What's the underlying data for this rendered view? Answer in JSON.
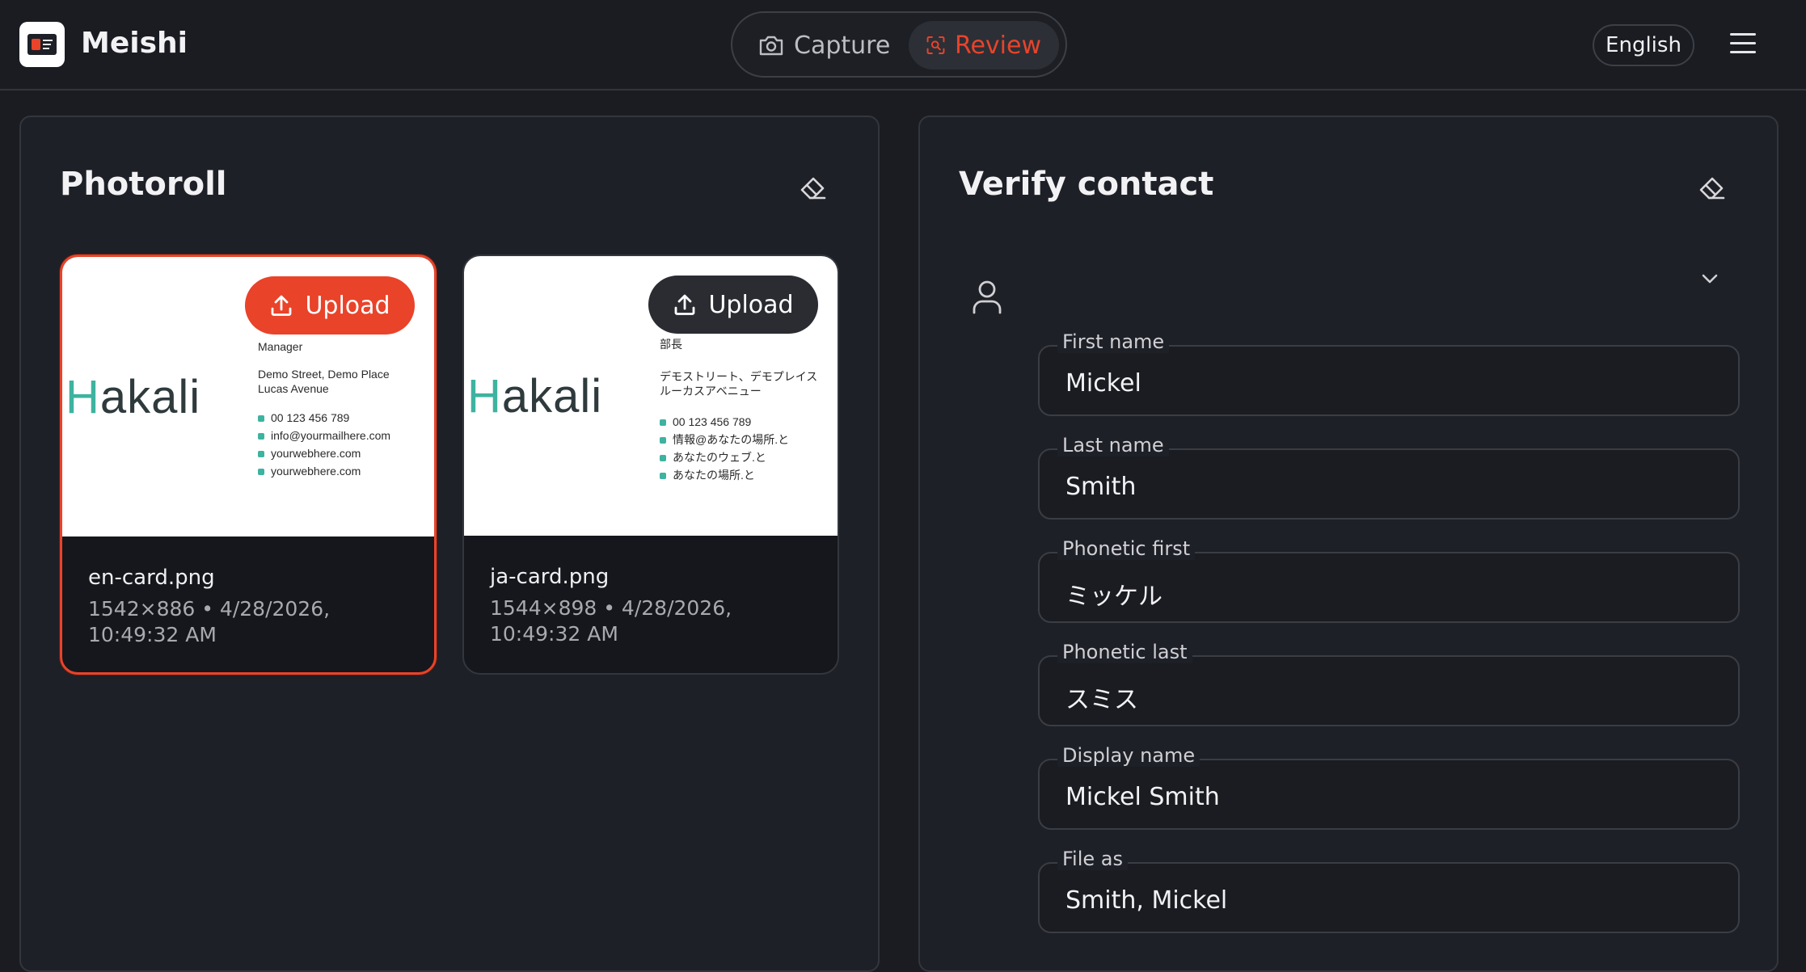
{
  "header": {
    "app_title": "Meishi",
    "nav": {
      "capture_label": "Capture",
      "review_label": "Review"
    },
    "language": "English",
    "accent_color": "#e9432a"
  },
  "photoroll": {
    "title": "Photoroll",
    "cards": [
      {
        "upload_label": "Upload",
        "file_name": "en-card.png",
        "meta": "1542×886 • 4/28/2026, 10:49:32 AM",
        "selected": true,
        "preview": {
          "logo_prefix": "H",
          "logo_suffix": "akali",
          "role": "Manager",
          "address_line1": "Demo Street, Demo Place",
          "address_line2": "Lucas Avenue",
          "phone": "00 123 456 789",
          "email": "info@yourmailhere.com",
          "web": "yourwebhere.com",
          "social": "yourwebhere.com"
        }
      },
      {
        "upload_label": "Upload",
        "file_name": "ja-card.png",
        "meta": "1544×898 • 4/28/2026, 10:49:32 AM",
        "selected": false,
        "preview": {
          "logo_prefix": "H",
          "logo_suffix": "akali",
          "role": "部長",
          "address_line1": "デモストリート、デモプレイス",
          "address_line2": "ルーカスアベニュー",
          "phone": "00 123 456 789",
          "email": "情報@あなたの場所.と",
          "web": "あなたのウェブ.と",
          "social": "あなたの場所.と"
        }
      }
    ]
  },
  "verify": {
    "title": "Verify contact",
    "fields": [
      {
        "label": "First name",
        "value": "Mickel"
      },
      {
        "label": "Last name",
        "value": "Smith"
      },
      {
        "label": "Phonetic first",
        "value": "ミッケル"
      },
      {
        "label": "Phonetic last",
        "value": "スミス"
      },
      {
        "label": "Display name",
        "value": "Mickel Smith"
      },
      {
        "label": "File as",
        "value": "Smith, Mickel"
      }
    ]
  },
  "icons": [
    "app-logo-icon",
    "camera-icon",
    "scan-icon",
    "menu-icon",
    "eraser-icon",
    "upload-icon",
    "person-icon",
    "chevron-down-icon"
  ]
}
